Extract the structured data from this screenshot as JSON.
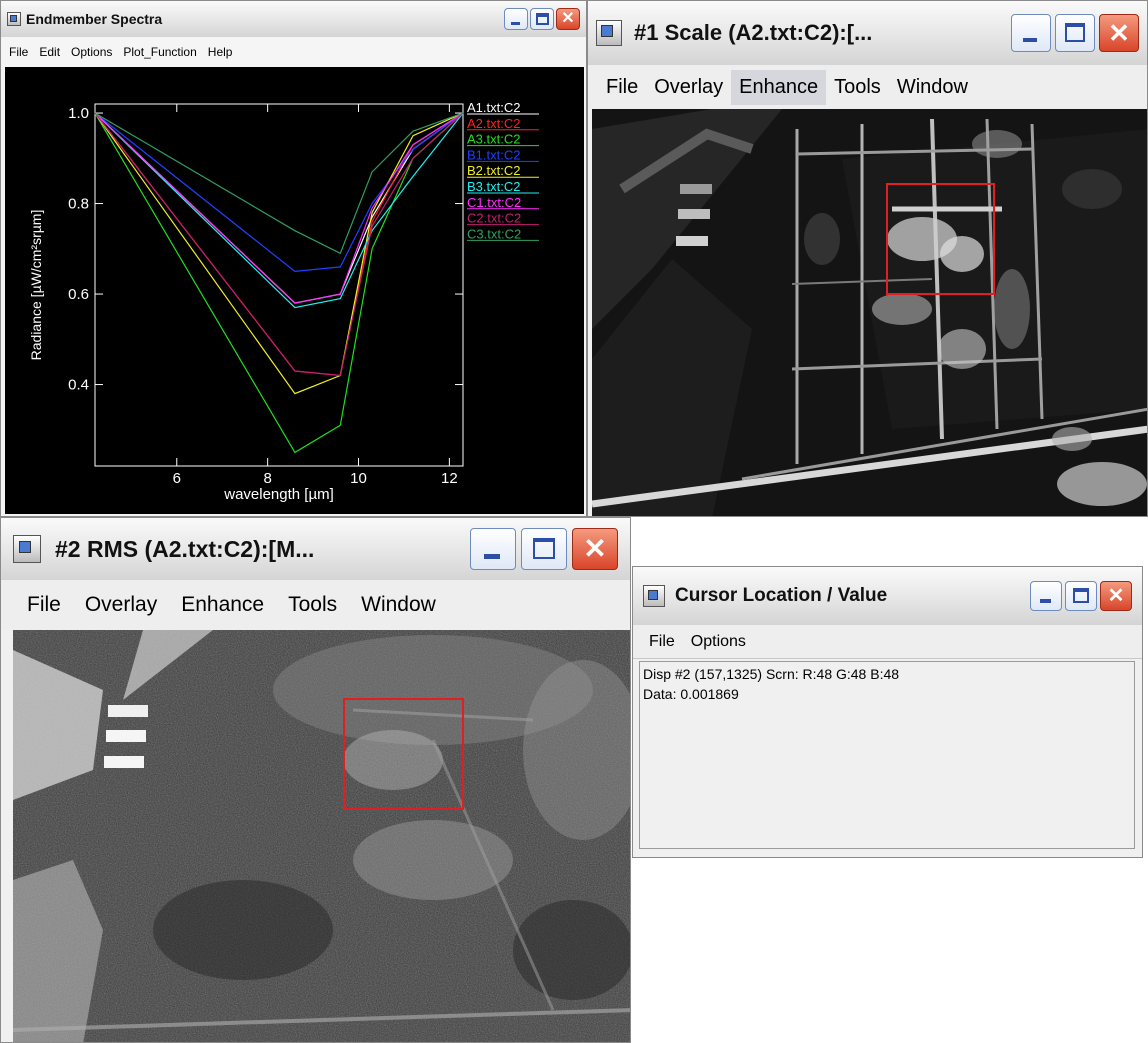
{
  "spectra_window": {
    "title": "Endmember Spectra",
    "menu": [
      "File",
      "Edit",
      "Options",
      "Plot_Function",
      "Help"
    ]
  },
  "scale_window": {
    "title": "#1 Scale (A2.txt:C2):[...",
    "menu": [
      "File",
      "Overlay",
      "Enhance",
      "Tools",
      "Window"
    ],
    "active_menu": "Enhance"
  },
  "rms_window": {
    "title": "#2 RMS (A2.txt:C2):[M...",
    "menu": [
      "File",
      "Overlay",
      "Enhance",
      "Tools",
      "Window"
    ]
  },
  "cursor_window": {
    "title": "Cursor Location / Value",
    "menu": [
      "File",
      "Options"
    ],
    "line1": "Disp #2 (157,1325) Scrn: R:48 G:48 B:48",
    "line2": "Data: 0.001869"
  },
  "colors": {
    "selection_box": "#e02020",
    "plot_background": "#000000"
  },
  "chart_data": {
    "type": "line",
    "title": "",
    "xlabel": "wavelength [µm]",
    "ylabel": "Radiance [µW/cm²srµm]",
    "xlim": [
      4.2,
      12.3
    ],
    "ylim": [
      0.22,
      1.02
    ],
    "xticks": [
      "6",
      "8",
      "10",
      "12"
    ],
    "yticks": [
      "0.4",
      "0.6",
      "0.8",
      "1.0"
    ],
    "x": [
      4.2,
      8.6,
      9.6,
      10.3,
      11.2,
      12.3
    ],
    "legend_placement": "right",
    "series": [
      {
        "name": "A1.txt:C2",
        "color": "#ffffff",
        "values": [
          1.0,
          0.58,
          0.6,
          0.77,
          0.92,
          1.0
        ]
      },
      {
        "name": "A2.txt:C2",
        "color": "#ff2020",
        "values": [
          1.0,
          0.43,
          0.42,
          0.76,
          0.93,
          1.0
        ]
      },
      {
        "name": "A3.txt:C2",
        "color": "#20e020",
        "values": [
          1.0,
          0.25,
          0.31,
          0.7,
          0.9,
          1.0
        ]
      },
      {
        "name": "B1.txt:C2",
        "color": "#2040ff",
        "values": [
          1.0,
          0.65,
          0.66,
          0.8,
          0.92,
          1.0
        ]
      },
      {
        "name": "B2.txt:C2",
        "color": "#f0f020",
        "values": [
          1.0,
          0.38,
          0.42,
          0.78,
          0.95,
          1.0
        ]
      },
      {
        "name": "B3.txt:C2",
        "color": "#20f0f0",
        "values": [
          1.0,
          0.57,
          0.59,
          0.74,
          0.86,
          1.0
        ]
      },
      {
        "name": "C1.txt:C2",
        "color": "#ff30ff",
        "values": [
          1.0,
          0.58,
          0.6,
          0.79,
          0.93,
          1.0
        ]
      },
      {
        "name": "C2.txt:C2",
        "color": "#c02070",
        "values": [
          1.0,
          0.43,
          0.42,
          0.75,
          0.9,
          1.0
        ]
      },
      {
        "name": "C3.txt:C2",
        "color": "#30a060",
        "values": [
          1.0,
          0.74,
          0.69,
          0.87,
          0.96,
          1.0
        ]
      }
    ]
  }
}
